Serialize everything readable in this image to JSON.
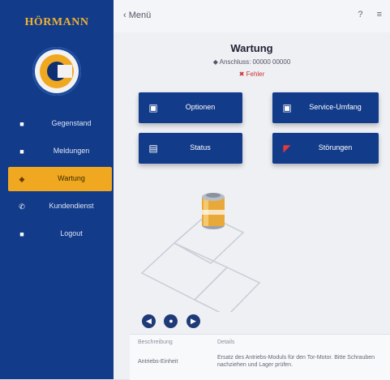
{
  "sidebar": {
    "brand": "HÖRMANN",
    "items": [
      {
        "label": "Gegenstand",
        "icon": "home-icon",
        "glyph": "■"
      },
      {
        "label": "Meldungen",
        "icon": "bell-icon",
        "glyph": "■"
      },
      {
        "label": "Wartung",
        "icon": "wrench-icon",
        "glyph": "◆",
        "active": true
      },
      {
        "label": "Kundendienst",
        "icon": "phone-icon",
        "glyph": "✆"
      },
      {
        "label": "Logout",
        "icon": "lock-icon",
        "glyph": "■"
      }
    ]
  },
  "topbar": {
    "back_label": "‹  Menü",
    "icons": [
      "question-icon",
      "menu-icon"
    ],
    "icon_glyphs": [
      "?",
      "≡"
    ]
  },
  "header": {
    "title": "Wartung",
    "subtitle": "◆ Anschluss: 00000 00000",
    "status": "✖ Fehler"
  },
  "actions": [
    {
      "label": "Optionen",
      "icon": "device-icon",
      "glyph": "▣"
    },
    {
      "label": "Service-Umfang",
      "icon": "device-icon",
      "glyph": "▣"
    },
    {
      "label": "Status",
      "icon": "battery-icon",
      "glyph": "▤"
    },
    {
      "label": "Störungen",
      "icon": "alert-icon",
      "glyph": "◤"
    }
  ],
  "controls": [
    {
      "name": "previous-button",
      "glyph": "◀"
    },
    {
      "name": "play-button",
      "glyph": "●"
    },
    {
      "name": "next-button",
      "glyph": "▶"
    }
  ],
  "panel": {
    "col1_header": "Beschreibung",
    "col2_header": "Details",
    "key": "Antriebs-Einheit",
    "value": "Ersatz des Antriebs-Moduls für den Tor-Motor. Bitte Schrauben nachziehen und Lager prüfen."
  },
  "colors": {
    "sidebar": "#123b8a",
    "accent": "#f0a820",
    "button": "#123b8a",
    "alert": "#e53a3a"
  }
}
